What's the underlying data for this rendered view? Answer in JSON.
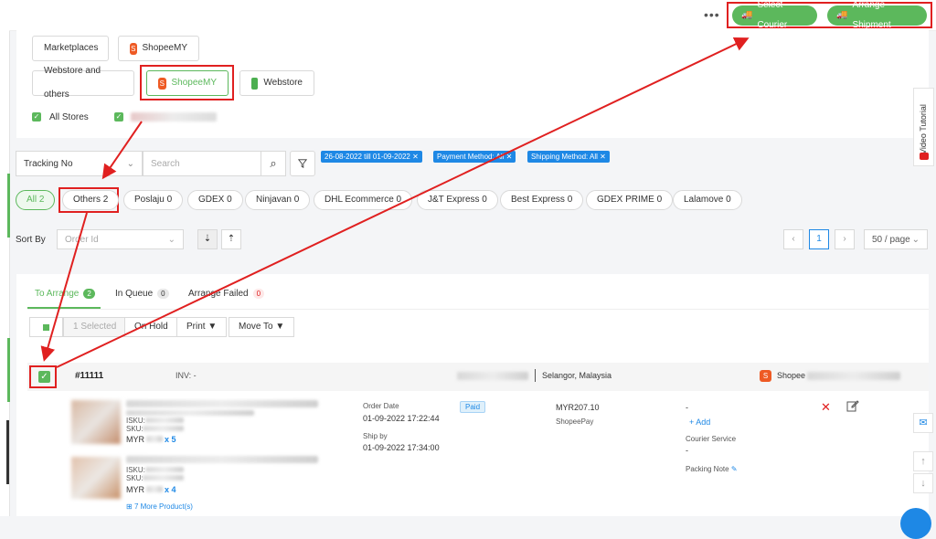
{
  "topbar": {
    "more": "•••",
    "select_courier": "Select Courier",
    "arrange_shipment": "Arrange Shipment"
  },
  "filters": {
    "marketplaces": "Marketplaces",
    "marketplace_store": "ShopeeMY",
    "webstore_others": "Webstore and others",
    "webstore_shopee": "ShopeeMY",
    "webstore": "Webstore",
    "all_stores": "All Stores"
  },
  "search": {
    "field": "Tracking No",
    "placeholder": "Search",
    "tags": [
      "26-08-2022 till 01-09-2022 ✕",
      "Payment Method: All ✕",
      "Shipping Method: All ✕"
    ]
  },
  "couriers": [
    "All 2",
    "Others 2",
    "Poslaju 0",
    "GDEX 0",
    "Ninjavan 0",
    "DHL Ecommerce 0",
    "J&T Express 0",
    "Best Express 0",
    "GDEX PRIME 0",
    "Lalamove 0"
  ],
  "sort": {
    "label": "Sort By",
    "placeholder": "Order Id"
  },
  "pagination": {
    "page": "1",
    "per_page": "50 / page",
    "prev": "‹",
    "next": "›"
  },
  "tabs": [
    {
      "label": "To Arrange",
      "count": "2"
    },
    {
      "label": "In Queue",
      "count": "0"
    },
    {
      "label": "Arrange Failed",
      "count": "0"
    }
  ],
  "toolbar": {
    "selected": "1 Selected",
    "on_hold": "On Hold",
    "print": "Print ▼",
    "move_to": "Move To ▼"
  },
  "order": {
    "id": "#11111",
    "inv": "INV: -",
    "location": "Selangor, Malaysia",
    "store": "Shopee",
    "isku": "ISKU:",
    "sku": "SKU:",
    "currency": "MYR",
    "qty1": "x 5",
    "qty2": "x 4",
    "more_products": "7 More Product(s)",
    "order_date_label": "Order Date",
    "order_date": "01-09-2022 17:22:44",
    "ship_by_label": "Ship by",
    "ship_by": "01-09-2022 17:34:00",
    "status": "Paid",
    "amount": "MYR207.10",
    "payment": "ShopeePay",
    "tracking": "-",
    "add": "+ Add",
    "courier_service_label": "Courier Service",
    "courier_service": "-",
    "packing_note": "Packing Note"
  },
  "video_tutorial": "Video Tutorial"
}
